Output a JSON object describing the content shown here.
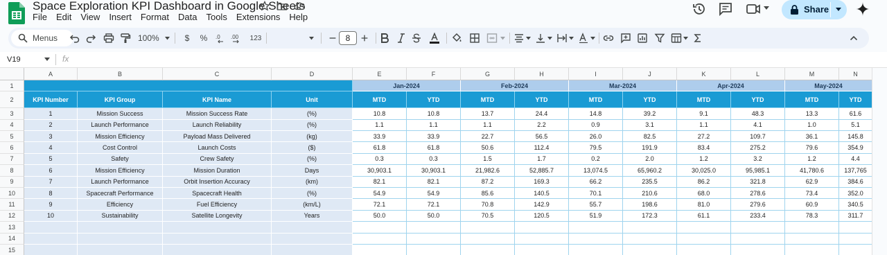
{
  "doc": {
    "title": "Space Exploration KPI Dashboard in Google Sheets"
  },
  "menu": [
    "File",
    "Edit",
    "View",
    "Insert",
    "Format",
    "Data",
    "Tools",
    "Extensions",
    "Help"
  ],
  "share": {
    "label": "Share"
  },
  "toolbar": {
    "menus_label": "Menus",
    "zoom": "100%",
    "currency": "$",
    "percent": "%",
    "dec_dec": ".0",
    "dec_inc": ".00",
    "format_123": "123",
    "font_size": "8"
  },
  "namebox": {
    "cell": "V19"
  },
  "formula": {
    "fx": "fx",
    "value": ""
  },
  "columns": [
    "A",
    "B",
    "C",
    "D",
    "E",
    "F",
    "G",
    "H",
    "I",
    "J",
    "K",
    "L",
    "M",
    "N"
  ],
  "rows": [
    "1",
    "2",
    "3",
    "4",
    "5",
    "6",
    "7",
    "8",
    "9",
    "10",
    "11",
    "12",
    "13",
    "14",
    "15"
  ],
  "headers": {
    "kpi_number": "KPI Number",
    "kpi_group": "KPI Group",
    "kpi_name": "KPI Name",
    "unit": "Unit",
    "mtd": "MTD",
    "ytd": "YTD"
  },
  "months": [
    "Jan-2024",
    "Feb-2024",
    "Mar-2024",
    "Apr-2024",
    "May-2024"
  ],
  "kpis": [
    {
      "num": "1",
      "group": "Mission Success",
      "name": "Mission Success Rate",
      "unit": "(%)",
      "vals": [
        "10.8",
        "10.8",
        "13.7",
        "24.4",
        "14.8",
        "39.2",
        "9.1",
        "48.3",
        "13.3",
        "61.6"
      ]
    },
    {
      "num": "2",
      "group": "Launch Performance",
      "name": "Launch Reliability",
      "unit": "(%)",
      "vals": [
        "1.1",
        "1.1",
        "1.1",
        "2.2",
        "0.9",
        "3.1",
        "1.1",
        "4.1",
        "1.0",
        "5.1"
      ]
    },
    {
      "num": "3",
      "group": "Mission Efficiency",
      "name": "Payload Mass Delivered",
      "unit": "(kg)",
      "vals": [
        "33.9",
        "33.9",
        "22.7",
        "56.5",
        "26.0",
        "82.5",
        "27.2",
        "109.7",
        "36.1",
        "145.8"
      ]
    },
    {
      "num": "4",
      "group": "Cost Control",
      "name": "Launch Costs",
      "unit": "($)",
      "vals": [
        "61.8",
        "61.8",
        "50.6",
        "112.4",
        "79.5",
        "191.9",
        "83.4",
        "275.2",
        "79.6",
        "354.9"
      ]
    },
    {
      "num": "5",
      "group": "Safety",
      "name": "Crew Safety",
      "unit": "(%)",
      "vals": [
        "0.3",
        "0.3",
        "1.5",
        "1.7",
        "0.2",
        "2.0",
        "1.2",
        "3.2",
        "1.2",
        "4.4"
      ]
    },
    {
      "num": "6",
      "group": "Mission Efficiency",
      "name": "Mission Duration",
      "unit": "Days",
      "vals": [
        "30,903.1",
        "30,903.1",
        "21,982.6",
        "52,885.7",
        "13,074.5",
        "65,960.2",
        "30,025.0",
        "95,985.1",
        "41,780.6",
        "137,765"
      ]
    },
    {
      "num": "7",
      "group": "Launch Performance",
      "name": "Orbit Insertion Accuracy",
      "unit": "(km)",
      "vals": [
        "82.1",
        "82.1",
        "87.2",
        "169.3",
        "66.2",
        "235.5",
        "86.2",
        "321.8",
        "62.9",
        "384.6"
      ]
    },
    {
      "num": "8",
      "group": "Spacecraft Performance",
      "name": "Spacecraft Health",
      "unit": "(%)",
      "vals": [
        "54.9",
        "54.9",
        "85.6",
        "140.5",
        "70.1",
        "210.6",
        "68.0",
        "278.6",
        "73.4",
        "352.0"
      ]
    },
    {
      "num": "9",
      "group": "Efficiency",
      "name": "Fuel Efficiency",
      "unit": "(km/L)",
      "vals": [
        "72.1",
        "72.1",
        "70.8",
        "142.9",
        "55.7",
        "198.6",
        "81.0",
        "279.6",
        "60.9",
        "340.5"
      ]
    },
    {
      "num": "10",
      "group": "Sustainability",
      "name": "Satellite Longevity",
      "unit": "Years",
      "vals": [
        "50.0",
        "50.0",
        "70.5",
        "120.5",
        "51.9",
        "172.3",
        "61.1",
        "233.4",
        "78.3",
        "311.7"
      ]
    }
  ],
  "colors": {
    "header_blue": "#1a9bd4",
    "month_band": "#aecdec",
    "left_fill": "#dfe9f5",
    "share_bg": "#c2e7ff",
    "sheets_green": "#0f9d58"
  }
}
